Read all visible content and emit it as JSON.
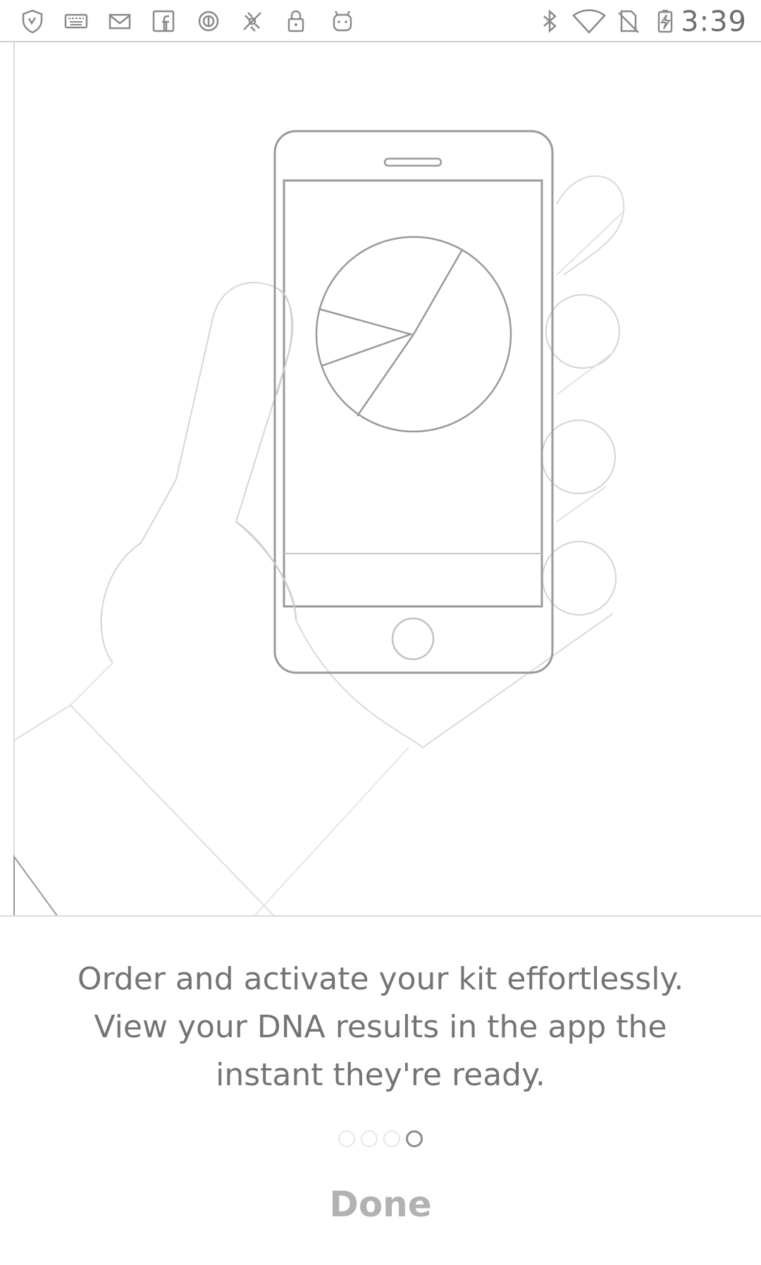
{
  "status_bar": {
    "time": "3:39",
    "left_icons": [
      "shield-icon",
      "keyboard-icon",
      "mail-icon",
      "facebook-icon",
      "circle-o-icon",
      "no-signal-icon",
      "lock-icon",
      "android-icon"
    ],
    "right_icons": [
      "bluetooth-icon",
      "wifi-icon",
      "no-sim-icon",
      "battery-charging-icon"
    ]
  },
  "onboarding": {
    "description_lines": [
      "Order and activate your kit effortlessly.",
      "View your DNA results in the app the",
      "instant they're ready."
    ],
    "page_count": 4,
    "active_page": 4,
    "done_label": "Done"
  },
  "colors": {
    "line_art": "#c9c9c9",
    "phone_outline": "#9a9a9a",
    "text": "#747474",
    "done": "#b2b2b2"
  }
}
